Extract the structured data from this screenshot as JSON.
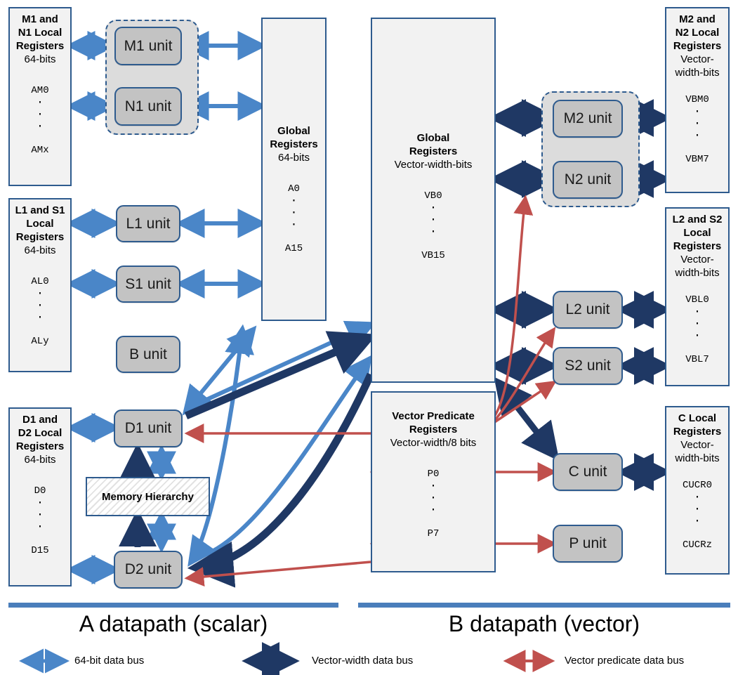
{
  "colors": {
    "scalar_bus": "#4a86c8",
    "vector_bus": "#1f3864",
    "predicate_bus": "#c0504d",
    "box_border": "#2e5b8e",
    "regbox_fill": "#f2f2f2",
    "unit_fill": "#c3c3c3",
    "group_fill": "#dcdcdc",
    "divider_bar": "#4a7ebb"
  },
  "a_datapath": {
    "label": "A datapath (scalar)",
    "register_files": [
      {
        "id": "m1-n1-local",
        "title": "M1 and\nN1 Local\nRegisters",
        "width": "64-bits",
        "first": "AM0",
        "last": "AMx"
      },
      {
        "id": "l1-s1-local",
        "title": "L1 and S1\nLocal\nRegisters",
        "width": "64-bits",
        "first": "AL0",
        "last": "ALy"
      },
      {
        "id": "d1-d2-local",
        "title": "D1 and\nD2 Local\nRegisters",
        "width": "64-bits",
        "first": "D0",
        "last": "D15"
      }
    ],
    "global_registers": {
      "title": "Global\nRegisters",
      "width": "64-bits",
      "first": "A0",
      "last": "A15"
    },
    "units": [
      {
        "id": "m1",
        "label": "M1 unit"
      },
      {
        "id": "n1",
        "label": "N1 unit"
      },
      {
        "id": "l1",
        "label": "L1 unit"
      },
      {
        "id": "s1",
        "label": "S1 unit"
      },
      {
        "id": "b",
        "label": "B unit"
      },
      {
        "id": "d1",
        "label": "D1 unit"
      },
      {
        "id": "d2",
        "label": "D2 unit"
      }
    ],
    "memory_hierarchy": "Memory Hierarchy"
  },
  "b_datapath": {
    "label": "B datapath (vector)",
    "register_files": [
      {
        "id": "m2-n2-local",
        "title": "M2 and\nN2 Local\nRegisters",
        "width": "Vector-\nwidth-bits",
        "first": "VBM0",
        "last": "VBM7"
      },
      {
        "id": "l2-s2-local",
        "title": "L2 and S2\nLocal\nRegisters",
        "width": "Vector-\nwidth-bits",
        "first": "VBL0",
        "last": "VBL7"
      },
      {
        "id": "c-local",
        "title": "C Local\nRegisters",
        "width": "Vector-\nwidth-bits",
        "first": "CUCR0",
        "last": "CUCRz"
      }
    ],
    "global_registers": {
      "title": "Global\nRegisters",
      "width": "Vector-width-bits",
      "first": "VB0",
      "last": "VB15"
    },
    "predicate_registers": {
      "title": "Vector Predicate\nRegisters",
      "width": "Vector-width/8 bits",
      "first": "P0",
      "last": "P7"
    },
    "units": [
      {
        "id": "m2",
        "label": "M2 unit"
      },
      {
        "id": "n2",
        "label": "N2 unit"
      },
      {
        "id": "l2",
        "label": "L2 unit"
      },
      {
        "id": "s2",
        "label": "S2 unit"
      },
      {
        "id": "c",
        "label": "C unit"
      },
      {
        "id": "p",
        "label": "P unit"
      }
    ]
  },
  "legend": [
    {
      "id": "scalar",
      "text": "64-bit data bus",
      "color": "#4a86c8"
    },
    {
      "id": "vector",
      "text": "Vector-width data bus",
      "color": "#1f3864"
    },
    {
      "id": "predicate",
      "text": "Vector predicate data bus",
      "color": "#c0504d"
    }
  ]
}
